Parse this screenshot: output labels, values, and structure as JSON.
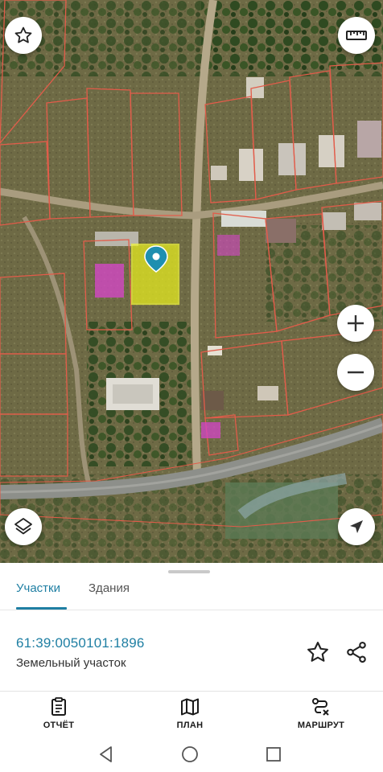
{
  "map": {
    "buttons": {
      "favorite_icon": "star-outline-icon",
      "ruler_icon": "ruler-icon",
      "zoom_in_icon": "plus-icon",
      "zoom_out_icon": "minus-icon",
      "layers_icon": "layers-icon",
      "locate_icon": "navigation-arrow-icon"
    },
    "colors": {
      "parcel_border": "#e25c4a",
      "selected_parcel_fill": "#e8ee1f",
      "marker": "#1f8fb0",
      "building_highlight": "#d646c8"
    }
  },
  "sheet": {
    "tabs": [
      {
        "label": "Участки",
        "active": true
      },
      {
        "label": "Здания",
        "active": false
      }
    ],
    "parcel": {
      "number": "61:39:0050101:1896",
      "type": "Земельный участок"
    },
    "icons": {
      "favorite": "star-outline-icon",
      "share": "share-icon"
    }
  },
  "actions": [
    {
      "label": "ОТЧЁТ",
      "icon": "report-icon"
    },
    {
      "label": "ПЛАН",
      "icon": "map-plan-icon"
    },
    {
      "label": "МАРШРУТ",
      "icon": "route-icon"
    }
  ],
  "system_nav": {
    "back_icon": "triangle-back-icon",
    "home_icon": "circle-home-icon",
    "recent_icon": "square-recent-icon"
  },
  "accent_color": "#1f7fa3"
}
